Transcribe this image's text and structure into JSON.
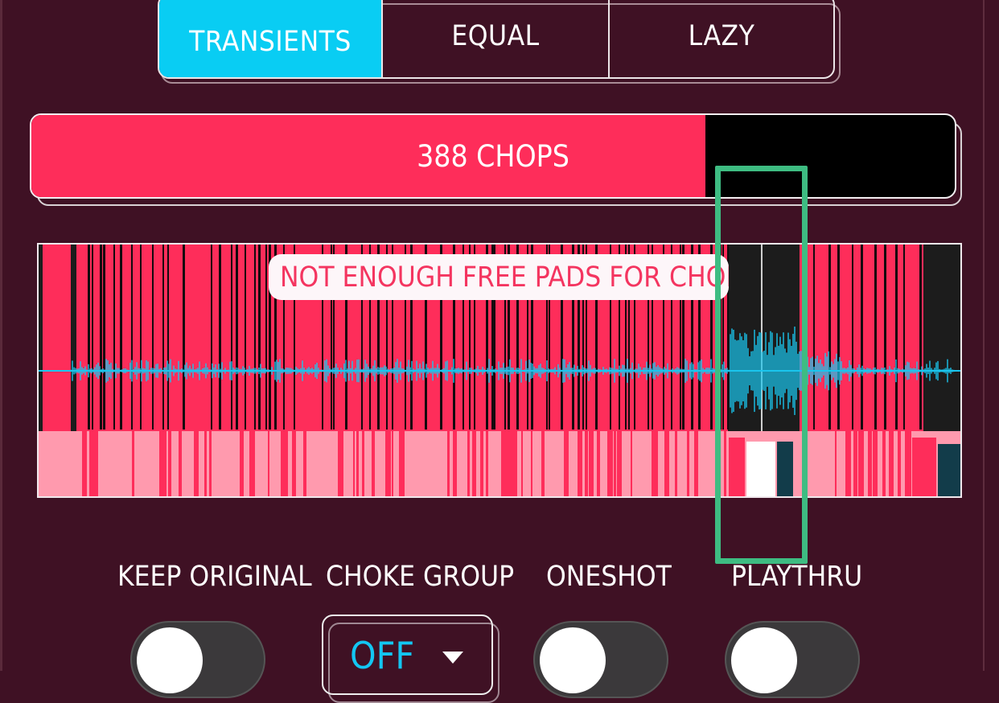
{
  "modes": {
    "items": [
      {
        "id": "transients",
        "label": "TRANSIENTS",
        "active": true
      },
      {
        "id": "equal",
        "label": "EQUAL",
        "active": false
      },
      {
        "id": "lazy",
        "label": "LAZY",
        "active": false
      }
    ]
  },
  "chops": {
    "label": "388 CHOPS",
    "progress": 0.73,
    "fill_color": "#fe2d5a",
    "track_color": "#000000"
  },
  "waveform": {
    "warning": "NOT ENOUGH FREE PADS FOR CHOP",
    "chop_color": "#fe2d5a",
    "pad_color": "#ff9aae",
    "wave_color": "#1bc5ee"
  },
  "options": {
    "keep_original": {
      "label": "KEEP ORIGINAL",
      "on": false
    },
    "choke_group": {
      "label": "CHOKE GROUP",
      "value": "OFF",
      "icon": "chevron-down-icon"
    },
    "oneshot": {
      "label": "ONESHOT",
      "on": false
    },
    "playthru": {
      "label": "PLAYTHRU",
      "on": false
    }
  },
  "colors": {
    "background": "#3f1124",
    "accent": "#09cdf3",
    "highlight": "#3ebc82"
  }
}
